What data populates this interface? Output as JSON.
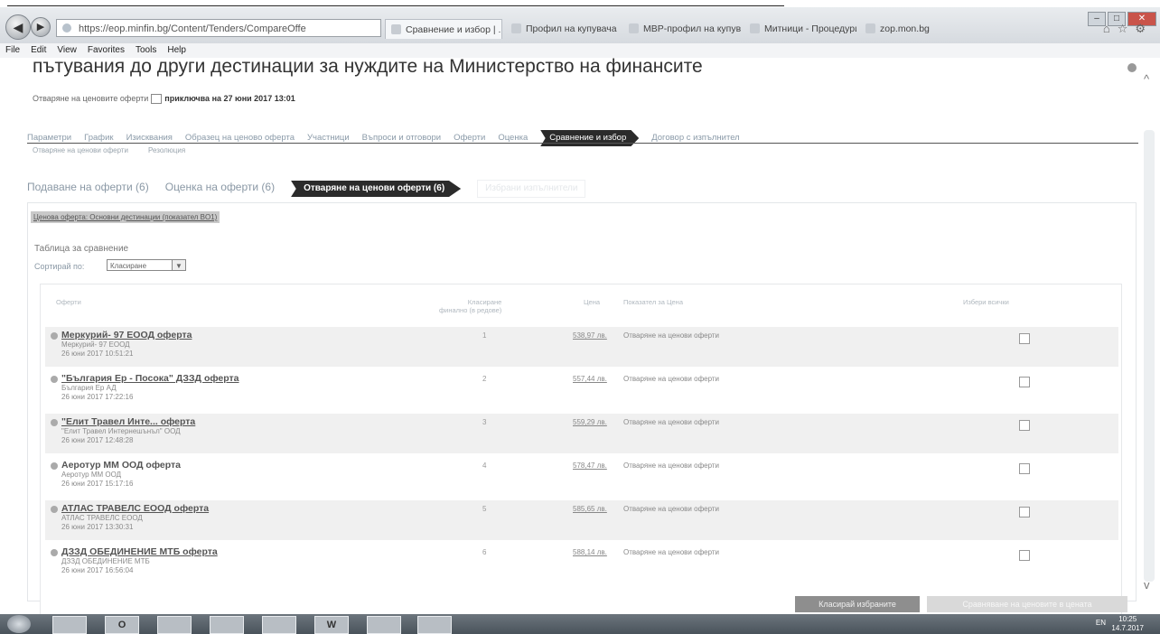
{
  "browser": {
    "address": "https://eop.minfin.bg/Content/Tenders/CompareOffe",
    "tabs": [
      {
        "label": "Сравнение и избор | ...",
        "close": "×"
      },
      {
        "label": "Профил на купувача ..."
      },
      {
        "label": "МВР-профил на купува..."
      },
      {
        "label": "Митници - Процедури"
      },
      {
        "label": "zop.mon.bg"
      }
    ],
    "menu": [
      "File",
      "Edit",
      "View",
      "Favorites",
      "Tools",
      "Help"
    ]
  },
  "page": {
    "title": "пътувания до други дестинации за нуждите на Министерство на финансите",
    "open_label": "Отваряне на ценовите оферти",
    "open_value": "приключва на 27 юни 2017 13:01",
    "main_tabs": [
      "Параметри",
      "График",
      "Изисквания",
      "Образец на ценово оферта",
      "Участници",
      "Въпроси и отговори",
      "Оферти",
      "Оценка",
      "Сравнение и избор",
      "Договор с изпълнител"
    ],
    "sub_tabs": [
      "Отваряне на ценови оферти",
      "Резолюция"
    ],
    "stage_tabs": [
      "Подаване на оферти (6)",
      "Оценка на оферти (6)",
      "Отваряне на ценови оферти (6)",
      "Избрани изпълнители"
    ],
    "criterion": "Ценова оферта: Основни дестинации (показател BO1)",
    "compare_label": "Таблица за сравнение",
    "sort_label": "Сортирай по:",
    "sort_value": "Класиране",
    "columns": {
      "offer": "Оферти",
      "rank": "Класиране\nфинално (в редове)",
      "price": "Цена",
      "price_type": "Показател за Цена",
      "select_all": "Избери всички"
    },
    "rows": [
      {
        "name": "Меркурий- 97 ЕООД оферта",
        "company": "Меркурий- 97 ЕООД",
        "date": "26 юни 2017 10:51:21",
        "rank": "1",
        "price": "538,97 лв.",
        "type": "Отваряне на ценови оферти"
      },
      {
        "name": "\"България Ер - Посока\" ДЗЗД оферта",
        "company": "България Ер АД",
        "date": "26 юни 2017 17:22:16",
        "rank": "2",
        "price": "557,44 лв.",
        "type": "Отваряне на ценови оферти"
      },
      {
        "name": "\"Елит Травел Инте... оферта",
        "company": "\"Елит Травел Интернешънъл\" ООД",
        "date": "26 юни 2017 12:48:28",
        "rank": "3",
        "price": "559,29 лв.",
        "type": "Отваряне на ценови оферти"
      },
      {
        "name": "Аеротур ММ ООД оферта",
        "company": "Аеротур ММ ООД",
        "date": "26 юни 2017 15:17:16",
        "rank": "4",
        "price": "578,47 лв.",
        "type": "Отваряне на ценови оферти"
      },
      {
        "name": "АТЛАС ТРАВЕЛС ЕООД оферта",
        "company": "АТЛАС ТРАВЕЛС ЕООД",
        "date": "26 юни 2017 13:30:31",
        "rank": "5",
        "price": "585,65 лв.",
        "type": "Отваряне на ценови оферти"
      },
      {
        "name": "ДЗЗД ОБЕДИНЕНИЕ МТБ оферта",
        "company": "ДЗЗД ОБЕДИНЕНИЕ МТБ",
        "date": "26 юни 2017 16:56:04",
        "rank": "6",
        "price": "588,14 лв.",
        "type": "Отваряне на ценови оферти"
      }
    ],
    "btn_rank": "Класирай избраните",
    "btn_compare": "Сравняване на ценовите в цената"
  },
  "taskbar": {
    "apps": [
      "",
      "O",
      "",
      "",
      "",
      "W",
      "",
      ""
    ],
    "tray": "EN",
    "time": "10:25",
    "date": "14.7.2017"
  }
}
